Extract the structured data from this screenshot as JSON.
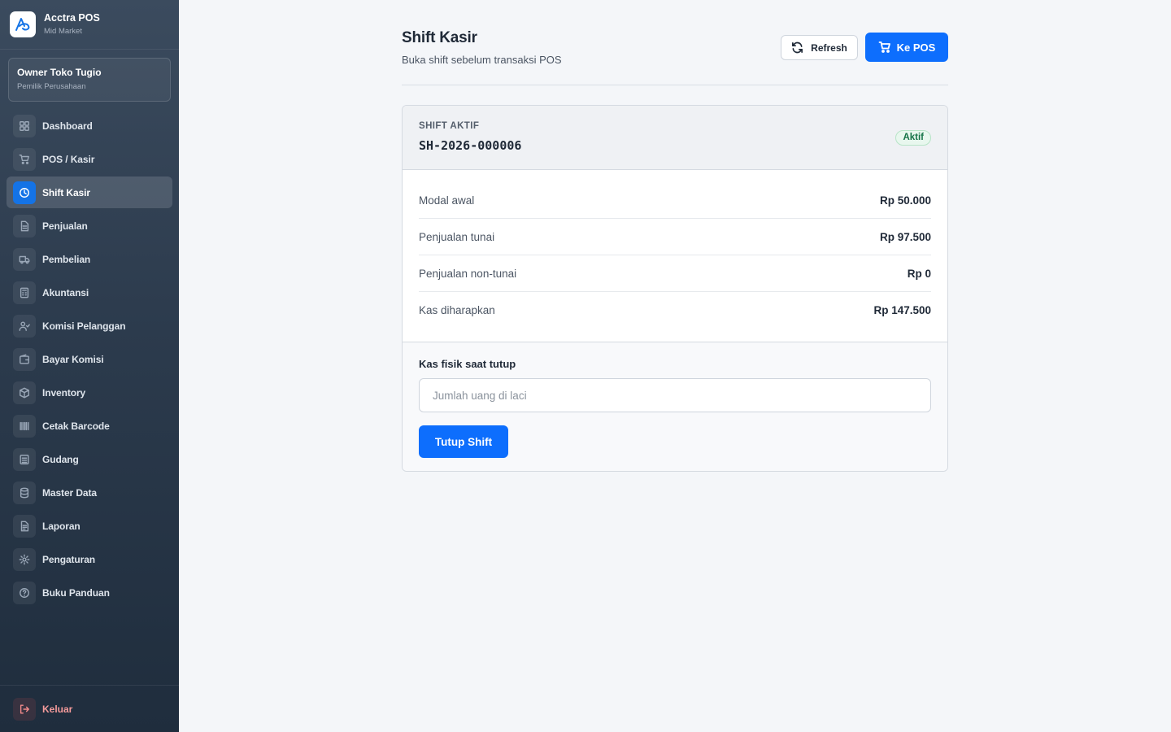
{
  "brand": {
    "name": "Acctra POS",
    "subtitle": "Mid Market",
    "logo_icon": "acctra-logo"
  },
  "user": {
    "name": "Owner Toko Tugio",
    "role": "Pemilik Perusahaan"
  },
  "nav": {
    "items": [
      {
        "label": "Dashboard",
        "icon": "grid-icon"
      },
      {
        "label": "POS / Kasir",
        "icon": "cart-icon"
      },
      {
        "label": "Shift Kasir",
        "icon": "clock-icon",
        "active": true
      },
      {
        "label": "Penjualan",
        "icon": "file-icon"
      },
      {
        "label": "Pembelian",
        "icon": "truck-icon"
      },
      {
        "label": "Akuntansi",
        "icon": "calculator-icon"
      },
      {
        "label": "Komisi Pelanggan",
        "icon": "user-check-icon"
      },
      {
        "label": "Bayar Komisi",
        "icon": "wallet-icon"
      },
      {
        "label": "Inventory",
        "icon": "box-icon"
      },
      {
        "label": "Cetak Barcode",
        "icon": "barcode-icon"
      },
      {
        "label": "Gudang",
        "icon": "warehouse-icon"
      },
      {
        "label": "Master Data",
        "icon": "database-icon"
      },
      {
        "label": "Laporan",
        "icon": "report-icon"
      },
      {
        "label": "Pengaturan",
        "icon": "gear-icon"
      },
      {
        "label": "Buku Panduan",
        "icon": "help-icon"
      }
    ],
    "logout_label": "Keluar"
  },
  "header": {
    "title": "Shift Kasir",
    "subtitle": "Buka shift sebelum transaksi POS",
    "refresh_label": "Refresh",
    "pos_label": "Ke POS"
  },
  "shift": {
    "section_label": "SHIFT AKTIF",
    "code": "SH-2026-000006",
    "status": "Aktif",
    "rows": [
      {
        "label": "Modal awal",
        "value": "Rp 50.000"
      },
      {
        "label": "Penjualan tunai",
        "value": "Rp 97.500"
      },
      {
        "label": "Penjualan non-tunai",
        "value": "Rp 0"
      },
      {
        "label": "Kas diharapkan",
        "value": "Rp 147.500"
      }
    ]
  },
  "close": {
    "label": "Kas fisik saat tutup",
    "input_value": "",
    "input_placeholder": "Jumlah uang di laci",
    "button_label": "Tutup Shift"
  },
  "colors": {
    "primary": "#0d6efd",
    "sidebar_top": "#3b4b5e",
    "sidebar_bottom": "#1f2d3d",
    "success_text": "#157347",
    "success_bg": "#e8f7ee"
  }
}
